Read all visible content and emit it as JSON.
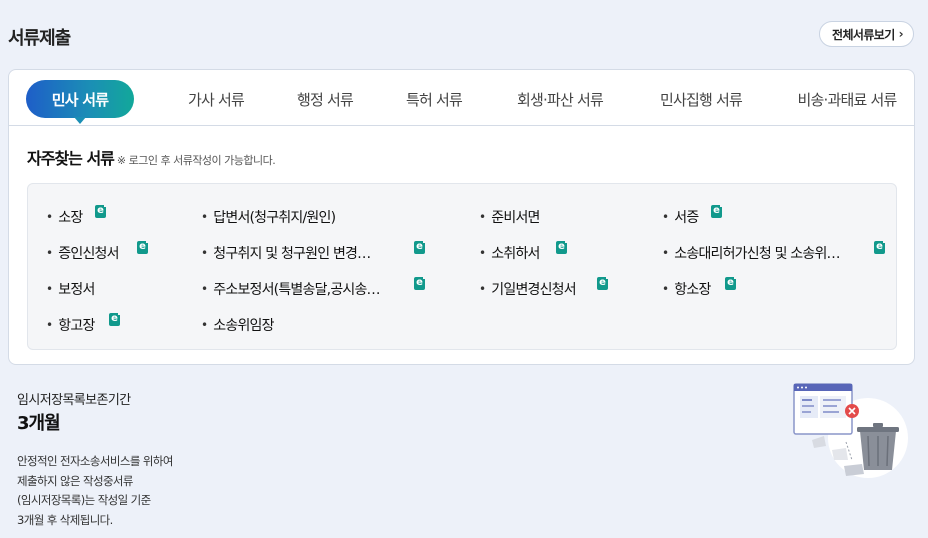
{
  "header": {
    "title": "서류제출",
    "view_all_label": "전체서류보기",
    "view_all_icon": "chevron-right-icon"
  },
  "tabs": [
    {
      "label": "민사 서류",
      "active": true
    },
    {
      "label": "가사 서류",
      "active": false
    },
    {
      "label": "행정 서류",
      "active": false
    },
    {
      "label": "특허 서류",
      "active": false
    },
    {
      "label": "회생·파산 서류",
      "active": false
    },
    {
      "label": "민사집행 서류",
      "active": false
    },
    {
      "label": "비송·과태료 서류",
      "active": false
    }
  ],
  "frequent": {
    "title": "자주찾는 서류",
    "note": "※ 로그인 후 서류작성이 가능합니다.",
    "items": [
      {
        "label": "소장",
        "e_form": true
      },
      {
        "label": "답변서(청구취지/원인)",
        "e_form": false
      },
      {
        "label": "준비서면",
        "e_form": false
      },
      {
        "label": "서증",
        "e_form": true
      },
      {
        "label": "증인신청서",
        "e_form": true
      },
      {
        "label": "청구취지 및 청구원인 변경…",
        "e_form": true
      },
      {
        "label": "소취하서",
        "e_form": true
      },
      {
        "label": "소송대리허가신청 및 소송위…",
        "e_form": true
      },
      {
        "label": "보정서",
        "e_form": false
      },
      {
        "label": "주소보정서(특별송달,공시송…",
        "e_form": true
      },
      {
        "label": "기일변경신청서",
        "e_form": true
      },
      {
        "label": "항소장",
        "e_form": true
      },
      {
        "label": "항고장",
        "e_form": true
      },
      {
        "label": "소송위임장",
        "e_form": false
      }
    ],
    "e_icon_glyph": "e",
    "bullet_glyph": "•"
  },
  "temp_storage": {
    "label": "임시저장목록보존기간",
    "value": "3개월",
    "description": [
      "안정적인 전자소송서비스를 위하여",
      "제출하지 않은 작성중서류",
      "(임시저장목록)는 작성일 기준",
      "3개월 후 삭제됩니다."
    ],
    "illustration_icon": "trash-document-illustration"
  },
  "colors": {
    "background": "#edf1f9",
    "accent_gradient_start": "#1e5ec8",
    "accent_gradient_end": "#12a89a",
    "e_form_icon": "#11998c"
  }
}
